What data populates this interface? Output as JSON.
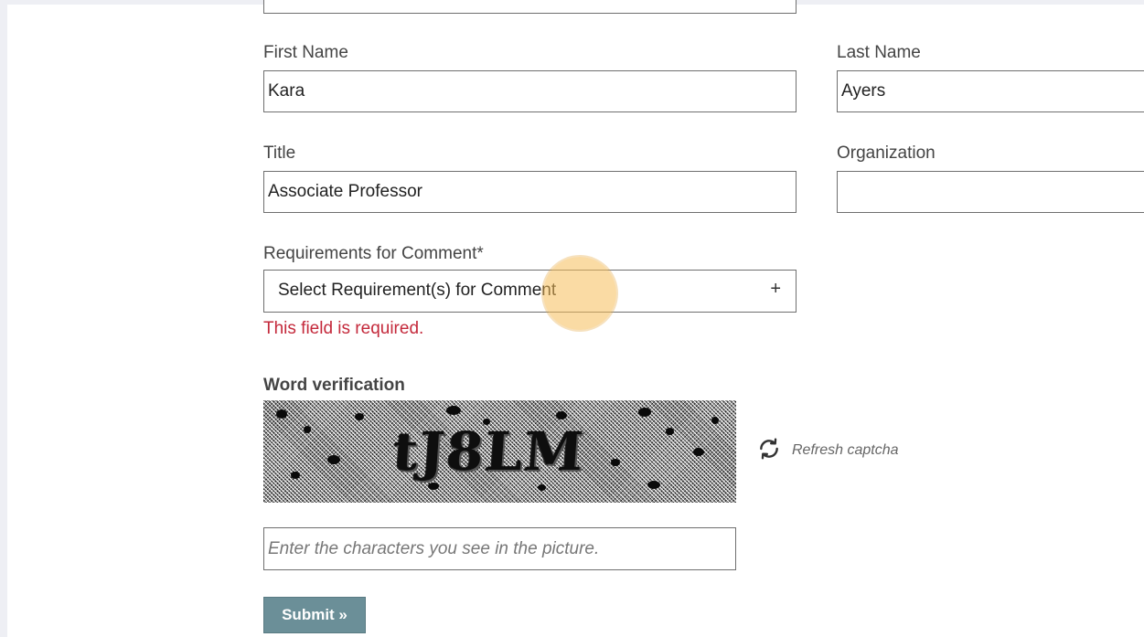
{
  "form": {
    "first_name": {
      "label": "First Name",
      "value": "Kara"
    },
    "last_name": {
      "label": "Last Name",
      "value": "Ayers"
    },
    "title": {
      "label": "Title",
      "value": "Associate Professor"
    },
    "organization": {
      "label": "Organization",
      "value": ""
    },
    "requirements": {
      "label": "Requirements for Comment*",
      "placeholder": "Select Requirement(s) for Comment",
      "error": "This field is required."
    },
    "captcha": {
      "label": "Word verification",
      "image_text": "tJ8LM",
      "refresh_label": "Refresh captcha",
      "input_placeholder": "Enter the characters you see in the picture."
    },
    "submit_label": "Submit »"
  },
  "icons": {
    "expand": "plus-icon",
    "refresh": "refresh-icon"
  },
  "colors": {
    "error": "#c4293b",
    "submit_bg": "#6b8f98",
    "cursor_highlight": "#f5be5a"
  }
}
